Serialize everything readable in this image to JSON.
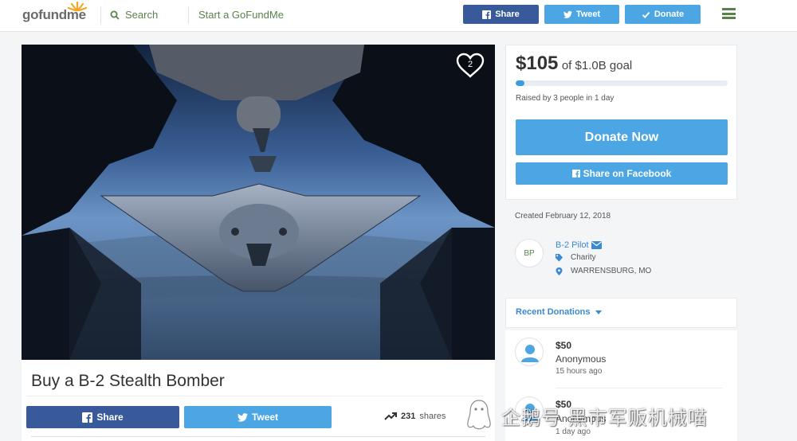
{
  "header": {
    "logo": "gofundme",
    "search_label": "Search",
    "start_label": "Start a GoFundMe",
    "share_label": "Share",
    "tweet_label": "Tweet",
    "donate_label": "Donate"
  },
  "campaign": {
    "title": "Buy a B-2 Stealth Bomber",
    "hearts": "2",
    "share_label": "Share",
    "tweet_label": "Tweet",
    "shares_count": "231",
    "shares_label": "shares"
  },
  "goal": {
    "raised": "$105",
    "goal_text": "of $1.0B goal",
    "progress_fraction": 0.04,
    "raised_by": "Raised by 3 people in 1 day",
    "donate_now_label": "Donate Now",
    "share_facebook_label": "Share on Facebook"
  },
  "organizer": {
    "created": "Created February 12, 2018",
    "initials": "BP",
    "name": "B-2 Pilot",
    "category": "Charity",
    "location": "WARRENSBURG, MO"
  },
  "recent": {
    "label": "Recent Donations"
  },
  "donations": [
    {
      "amount": "$50",
      "name": "Anonymous",
      "time": "15 hours ago"
    },
    {
      "amount": "$50",
      "name": "Anonymous",
      "time": "1 day ago"
    }
  ],
  "watermark": {
    "text": "企鹅号 黑市军贩机械喵"
  },
  "colors": {
    "brand_green": "#59824a",
    "facebook": "#385a9b",
    "accent_blue": "#4ca6e4",
    "link_blue": "#3b8ad1"
  }
}
